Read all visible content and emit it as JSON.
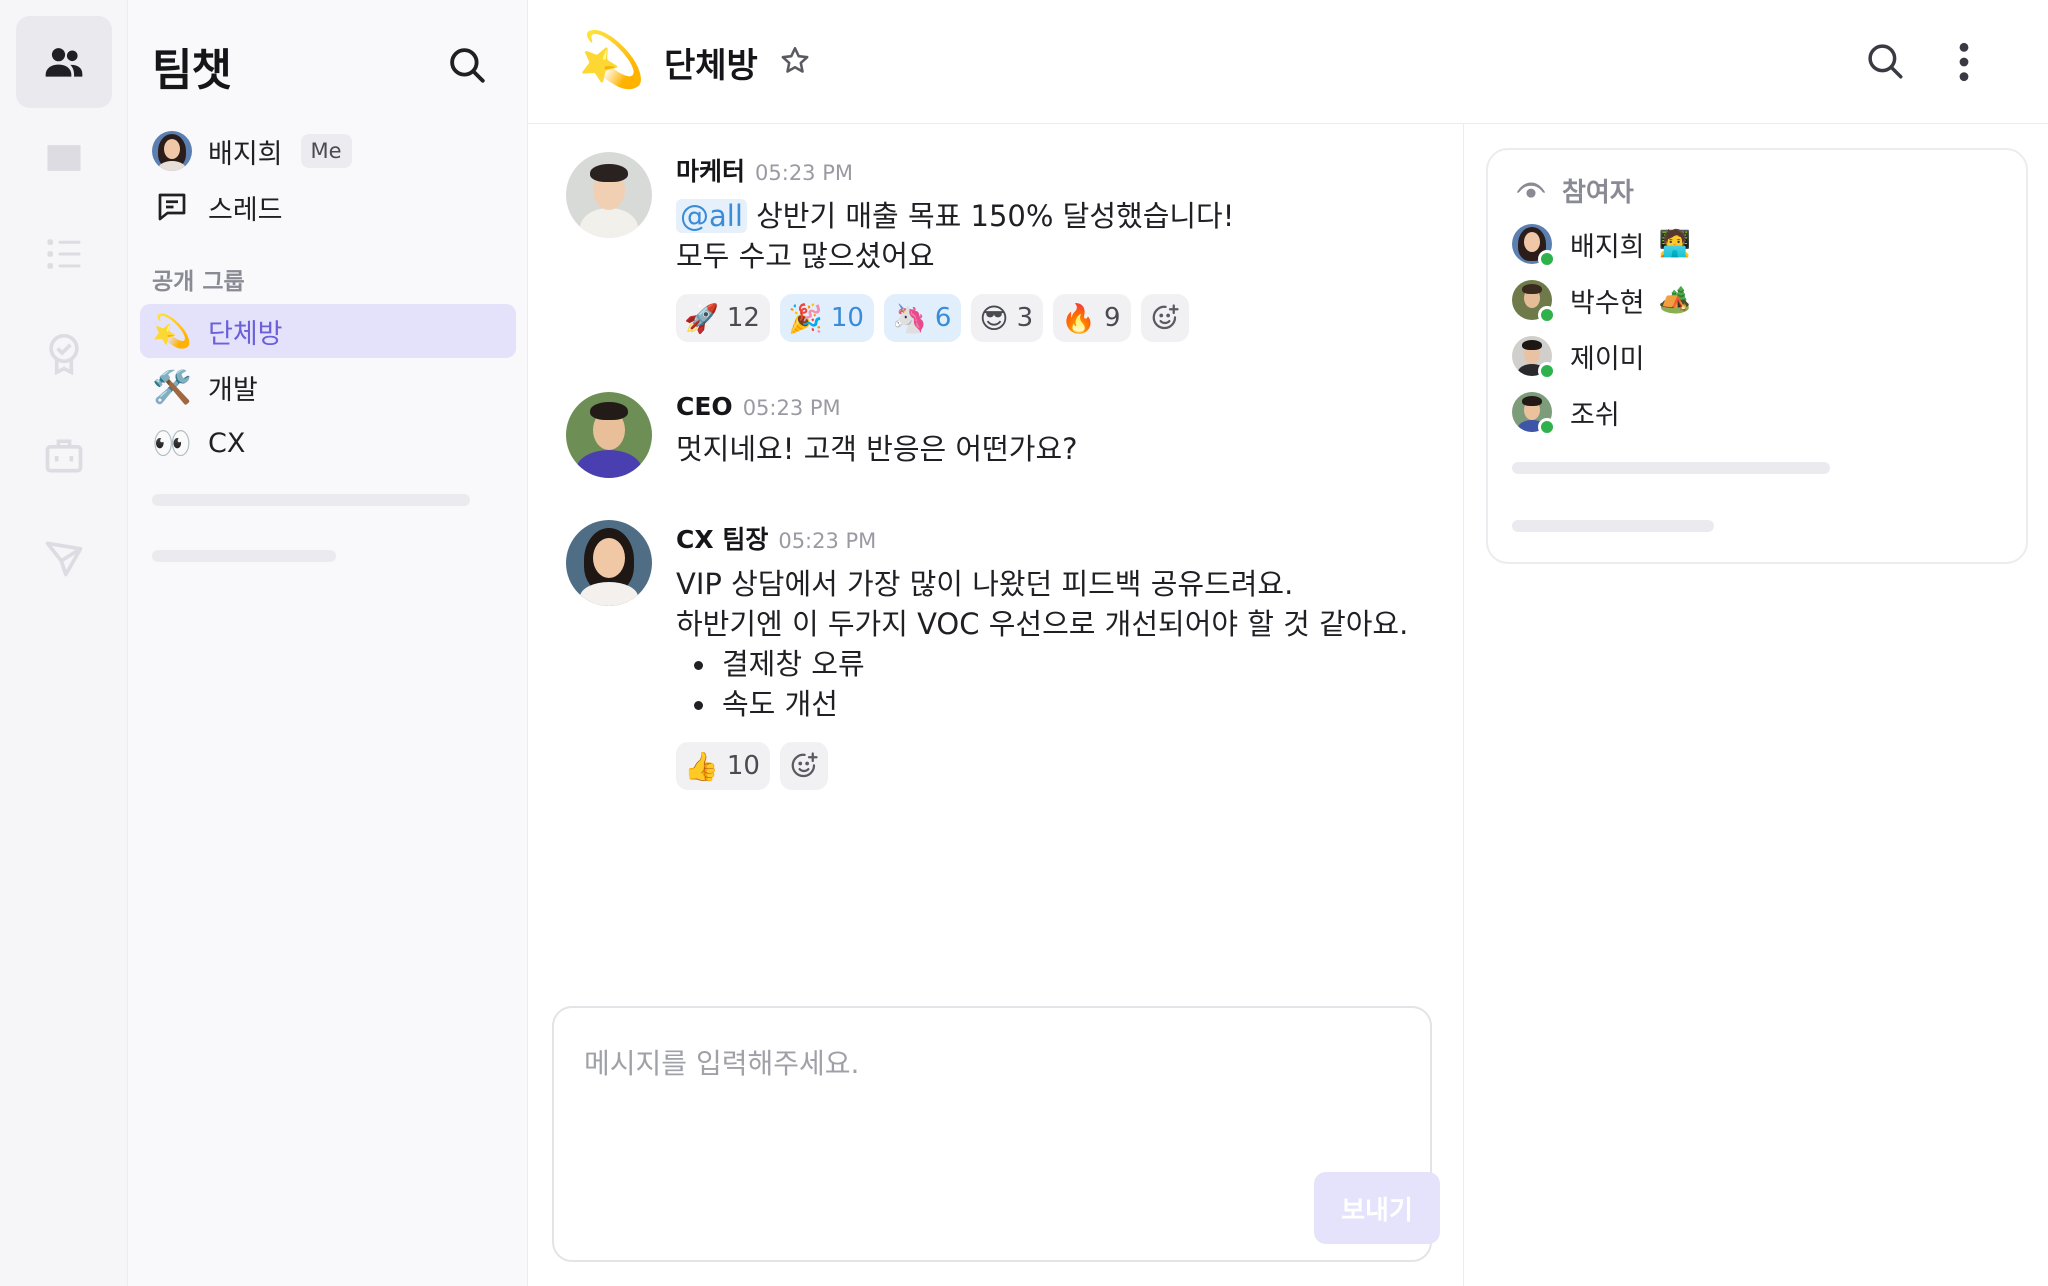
{
  "app": {
    "title": "팀챗"
  },
  "sidebar": {
    "me": {
      "name": "배지희",
      "badge": "Me"
    },
    "thread_label": "스레드",
    "section_label": "공개 그룹",
    "groups": [
      {
        "emoji": "💫",
        "label": "단체방",
        "active": true
      },
      {
        "emoji": "🛠️",
        "label": "개발",
        "active": false
      },
      {
        "emoji": "👀",
        "label": "CX",
        "active": false
      }
    ]
  },
  "header": {
    "emoji": "💫",
    "title": "단체방"
  },
  "messages": [
    {
      "author": "마케터",
      "time": "05:23 PM",
      "mention": "@all",
      "lines": [
        "상반기 매출 목표 150% 달성했습니다!",
        "모두 수고 많으셨어요"
      ],
      "reactions": [
        {
          "emoji": "🚀",
          "count": "12",
          "mine": false
        },
        {
          "emoji": "🎉",
          "count": "10",
          "mine": true
        },
        {
          "emoji": "🦄",
          "count": "6",
          "mine": true
        },
        {
          "emoji": "😎",
          "count": "3",
          "mine": false
        },
        {
          "emoji": "🔥",
          "count": "9",
          "mine": false
        }
      ]
    },
    {
      "author": "CEO",
      "time": "05:23 PM",
      "lines": [
        "멋지네요! 고객 반응은 어떤가요?"
      ]
    },
    {
      "author": "CX 팀장",
      "time": "05:23 PM",
      "lines": [
        "VIP 상담에서 가장 많이 나왔던 피드백 공유드려요.",
        "하반기엔 이 두가지 VOC 우선으로 개선되어야 할 것 같아요."
      ],
      "bullets": [
        "결제창 오류",
        "속도 개선"
      ],
      "reactions": [
        {
          "emoji": "👍",
          "count": "10",
          "mine": false
        }
      ]
    }
  ],
  "composer": {
    "placeholder": "메시지를 입력해주세요.",
    "send_label": "보내기"
  },
  "participants": {
    "title": "참여자",
    "members": [
      {
        "name": "배지희",
        "status_emoji": "🧑‍💻"
      },
      {
        "name": "박수현",
        "status_emoji": "🏕️"
      },
      {
        "name": "제이미",
        "status_emoji": ""
      },
      {
        "name": "조쉬",
        "status_emoji": ""
      }
    ]
  },
  "colors": {
    "accent": "#6b60d9",
    "active_bg": "#e4e2fb",
    "online": "#2fb24c",
    "mention": "#3a8bd8"
  },
  "icons": {
    "rail": [
      "people-icon",
      "inbox-icon",
      "list-icon",
      "badge-icon",
      "briefcase-icon",
      "send-icon"
    ]
  }
}
